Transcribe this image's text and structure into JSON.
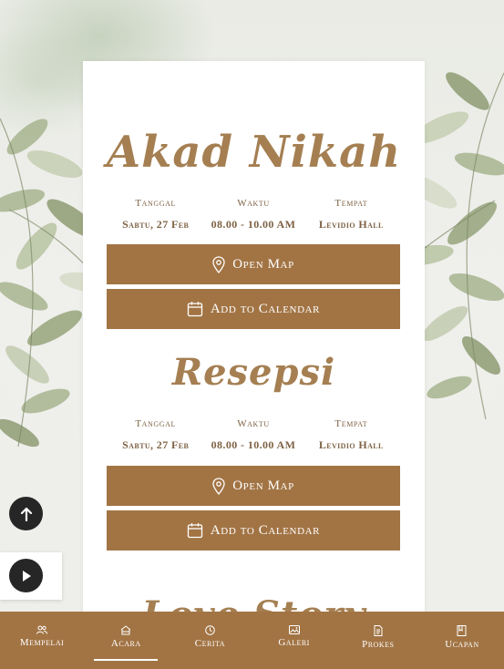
{
  "events": [
    {
      "title": "Akad Nikah",
      "date_label": "Tanggal",
      "date_value": "Sabtu, 27 Feb",
      "time_label": "Waktu",
      "time_value": "08.00 - 10.00 AM",
      "place_label": "Tempat",
      "place_value": "Levidio Hall",
      "map_button": "Open Map",
      "calendar_button": "Add to Calendar"
    },
    {
      "title": "Resepsi",
      "date_label": "Tanggal",
      "date_value": "Sabtu, 27 Feb",
      "time_label": "Waktu",
      "time_value": "08.00 - 10.00 AM",
      "place_label": "Tempat",
      "place_value": "Levidio Hall",
      "map_button": "Open Map",
      "calendar_button": "Add to Calendar"
    }
  ],
  "next_section_title_partial": "Love Story",
  "floating": {
    "scroll_top_icon": "arrow-up-icon",
    "music_icon": "play-icon"
  },
  "nav": {
    "active": "Acara",
    "items": [
      {
        "label": "Mempelai",
        "icon": "people-icon"
      },
      {
        "label": "Acara",
        "icon": "home-icon"
      },
      {
        "label": "Cerita",
        "icon": "clock-icon"
      },
      {
        "label": "Galeri",
        "icon": "image-icon"
      },
      {
        "label": "Prokes",
        "icon": "document-icon"
      },
      {
        "label": "Ucapan",
        "icon": "book-icon"
      }
    ]
  },
  "colors": {
    "accent": "#a27444",
    "title_text": "#a57f52",
    "info_text": "#7e6244",
    "card": "#ffffff",
    "fab": "#262626"
  }
}
